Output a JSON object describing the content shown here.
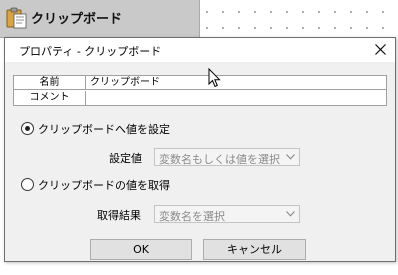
{
  "canvas": {
    "node": {
      "label": "クリップボード",
      "icon": "clipboard-icon"
    }
  },
  "dialog": {
    "title": "プロパティ - クリップボード",
    "close_icon": "close-icon",
    "properties": [
      {
        "key": "名前",
        "value": "クリップボード"
      },
      {
        "key": "コメント",
        "value": ""
      }
    ],
    "set_option": {
      "label": "クリップボードへ値を設定",
      "selected": true,
      "field_label": "設定値",
      "field_placeholder": "変数名もしくは値を選択"
    },
    "get_option": {
      "label": "クリップボードの値を取得",
      "selected": false,
      "field_label": "取得結果",
      "field_placeholder": "変数名を選択"
    },
    "ok_label": "OK",
    "cancel_label": "キャンセル"
  },
  "colors": {
    "dialog_bg": "#f0f0f0",
    "node_bg": "#c9c9c9",
    "button_bg": "#e1e1e1"
  }
}
